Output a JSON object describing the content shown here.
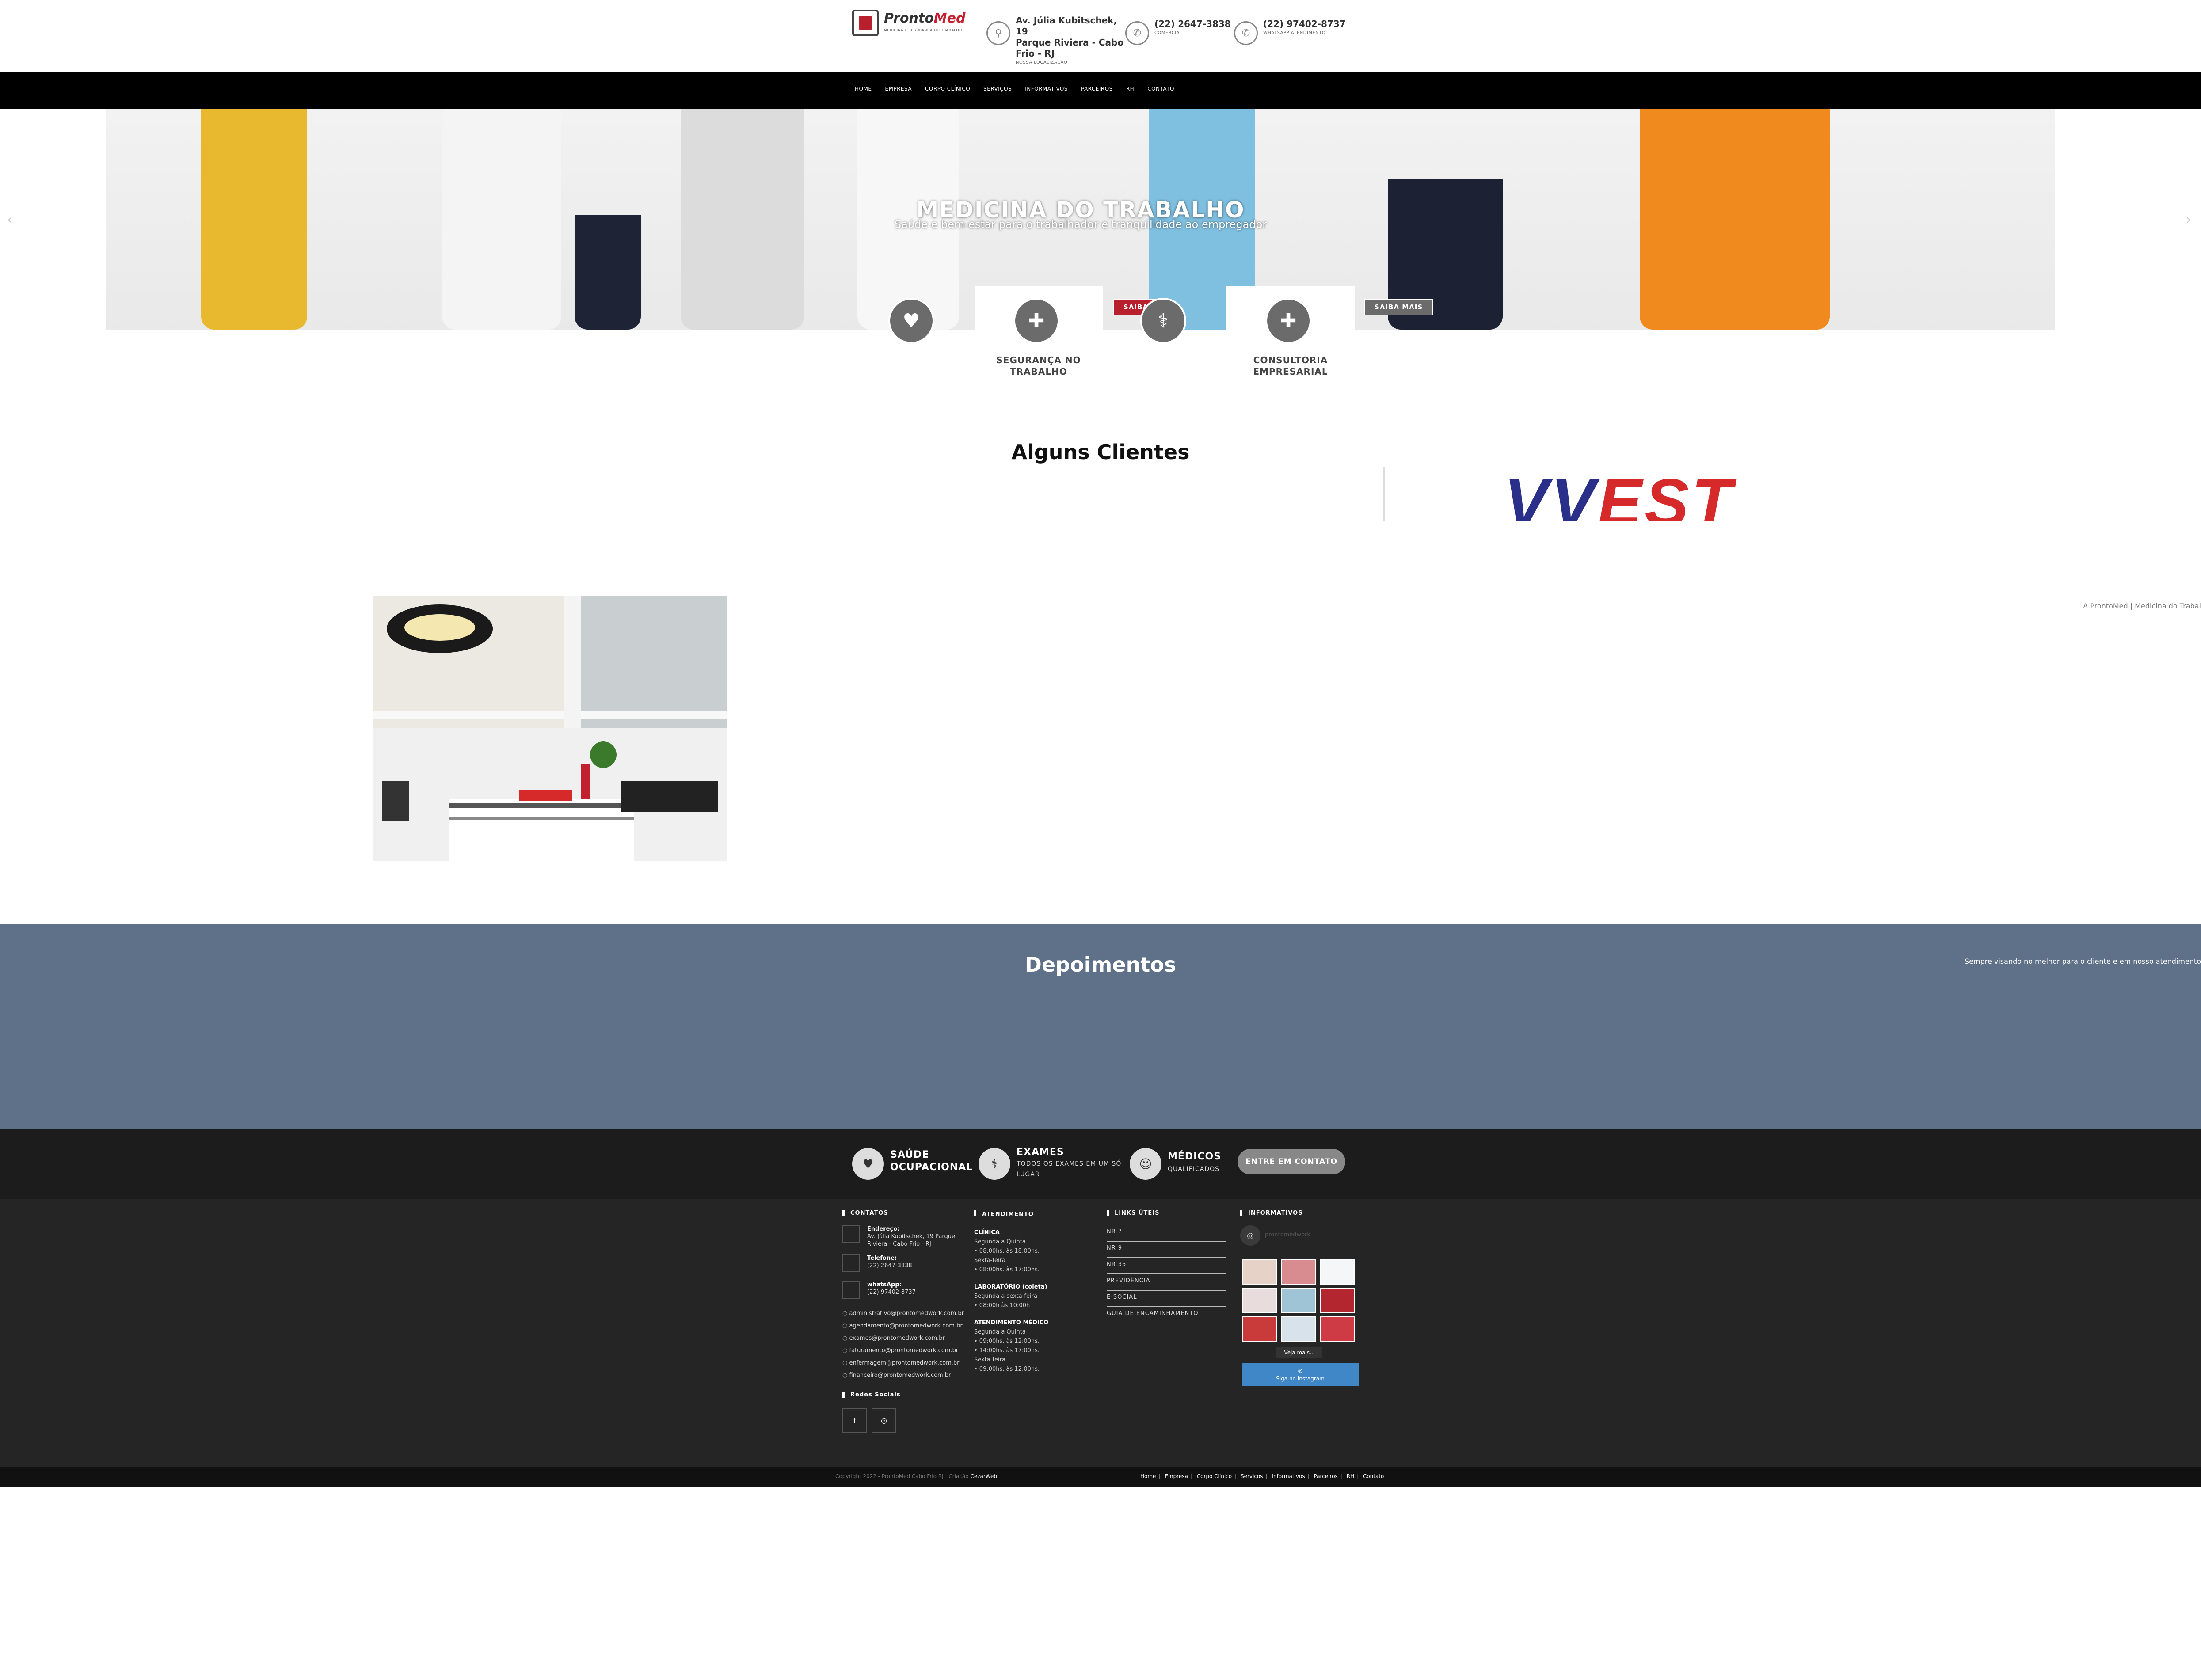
{
  "header": {
    "logo_main": "Pronto",
    "logo_accent": "Med",
    "logo_tagline": "MEDICINA E SEGURANÇA DO TRABALHO",
    "address_line1": "Av. Júlia Kubitschek, 19",
    "address_line2": "Parque Riviera - Cabo",
    "address_line3": "Frio - RJ",
    "address_sub": "NOSSA LOCALIZAÇÃO",
    "phone": "(22) 2647-3838",
    "phone_sub": "COMERCIAL",
    "whatsapp": "(22) 97402-8737",
    "whatsapp_sub": "WHATSAPP ATENDIMENTO"
  },
  "nav": {
    "items": [
      "HOME",
      "EMPRESA",
      "CORPO CLÍNICO",
      "SERVIÇOS",
      "INFORMATIVOS",
      "PARCEIROS",
      "RH",
      "CONTATO"
    ]
  },
  "hero": {
    "title": "MEDICINA DO TRABALHO",
    "subtitle": "Saúde e bem-estar para o trabalhador e tranquilidade ao empregador",
    "prev_arrow": "‹",
    "next_arrow": "›"
  },
  "features": {
    "card1_title_line1": "SEGURANÇA NO",
    "card1_title_line2": "TRABALHO",
    "card2_title_line1": "CONSULTORIA",
    "card2_title_line2": "EMPRESARIAL",
    "saiba1": "SAIBA",
    "saiba2": "SAIBA MAIS"
  },
  "clients": {
    "title": "Alguns Clientes",
    "logo_w": "VV",
    "logo_rest": "EST"
  },
  "about": {
    "side_note": "A ProntoMed | Medicina do Trabal"
  },
  "testimonials": {
    "title": "Depoimentos",
    "note": "Sempre visando no melhor para o cliente e em nosso atendimento"
  },
  "strip": {
    "item1_line1": "SAÚDE",
    "item1_line2": "OCUPACIONAL",
    "item2_title": "EXAMES",
    "item2_sub1": "TODOS OS EXAMES EM UM SÓ",
    "item2_sub2": "LUGAR",
    "item3_title": "MÉDICOS",
    "item3_sub": "QUALIFICADOS",
    "contact_button": "ENTRE EM CONTATO"
  },
  "footer": {
    "contacts_title": "CONTATOS",
    "address_label": "Endereço:",
    "address_l1": "Av. Júlia Kubitschek, 19 Parque",
    "address_l2": "Riviera - Cabo Frio - RJ",
    "phone_label": "Telefone:",
    "phone": "(22) 2647-3838",
    "whatsapp_label": "whatsApp:",
    "whatsapp": "(22) 97402-8737",
    "emails": [
      "administrativo@prontomedwork.com.br",
      "agendamento@prontomedwork.com.br",
      "exames@prontomedwork.com.br",
      "faturamento@prontomedwork.com.br",
      "enfermagem@prontomedwork.com.br",
      "financeiro@prontomedwork.com.br"
    ],
    "social_title": "Redes Sociais",
    "hours_title": "ATENDIMENTO",
    "clinic_label": "CLÍNICA",
    "clinic_l1": "Segunda a Quinta",
    "clinic_l2": "• 08:00hs. às 18:00hs.",
    "clinic_l3": "Sexta-feira",
    "clinic_l4": "• 08:00hs. às 17:00hs.",
    "lab_label": "LABORATÓRIO (coleta)",
    "lab_l1": "Segunda a sexta-feira",
    "lab_l2": "• 08:00h às 10:00h",
    "medical_label": "ATENDIMENTO MÉDICO",
    "medical_l1": "Segunda a Quinta",
    "medical_l2": "• 09:00hs. às 12:00hs.",
    "medical_l3": "• 14:00hs. às 17:00hs.",
    "medical_l4": "Sexta-feira",
    "medical_l5": "• 09:00hs. às 12:00hs.",
    "links_title": "LINKS ÚTEIS",
    "links": [
      "NR 7",
      "NR 9",
      "NR 35",
      "PREVIDÊNCIA",
      "E-SOCIAL",
      "GUIA DE ENCAMINHAMENTO"
    ],
    "info_title": "INFORMATIVOS",
    "insta_handle": "prontomedwork",
    "veja_mais": "Veja mais...",
    "insta_button": "Siga no Instagram"
  },
  "bottom": {
    "copyright": "Copyright 2022 - ProntoMed Cabo Frio RJ | Criação",
    "agency": "CezarWeb",
    "links": [
      "Home",
      "Empresa",
      "Corpo Clínico",
      "Serviços",
      "Informativos",
      "Parceiros",
      "RH",
      "Contato"
    ]
  },
  "colors": {
    "brand_red": "#c4202f",
    "nav_bg": "#000000",
    "testimonials_bg": "#5f7188",
    "footer_bg": "#252525",
    "instagram_button": "#3f87c7"
  }
}
